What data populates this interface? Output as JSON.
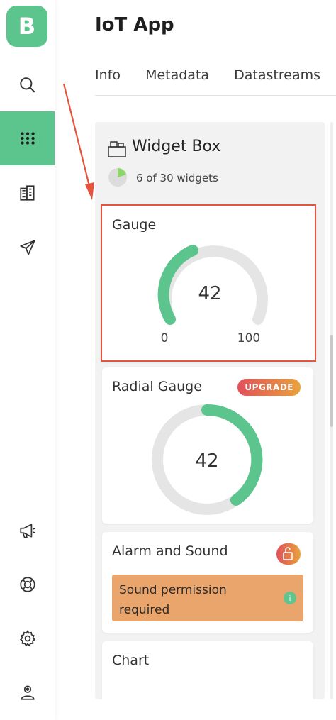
{
  "logo": {
    "letter": "B"
  },
  "sidebar": {
    "items": [
      {
        "icon": "search-icon"
      },
      {
        "icon": "grid-icon",
        "active": true
      },
      {
        "icon": "building-icon"
      },
      {
        "icon": "send-icon"
      },
      {
        "icon": "megaphone-icon"
      },
      {
        "icon": "lifebuoy-icon"
      },
      {
        "icon": "gear-icon"
      },
      {
        "icon": "user-icon"
      }
    ]
  },
  "header": {
    "title": "IoT App",
    "tabs": [
      "Info",
      "Metadata",
      "Datastreams"
    ]
  },
  "widget_box": {
    "title": "Widget Box",
    "count_label": "6 of 30 widgets",
    "used_fraction": 0.2,
    "widgets": [
      {
        "name": "Gauge",
        "value": "42",
        "min": "0",
        "max": "100"
      },
      {
        "name": "Radial Gauge",
        "value": "42",
        "badge": "UPGRADE"
      },
      {
        "name": "Alarm and Sound",
        "notice": "Sound permission required",
        "info_glyph": "i"
      },
      {
        "name": "Chart"
      }
    ]
  },
  "colors": {
    "brand": "#5cc48d",
    "highlight_border": "#e5533c",
    "warning": "#eaa56d",
    "upgrade_start": "#e24f5a",
    "upgrade_end": "#e8a33c"
  }
}
